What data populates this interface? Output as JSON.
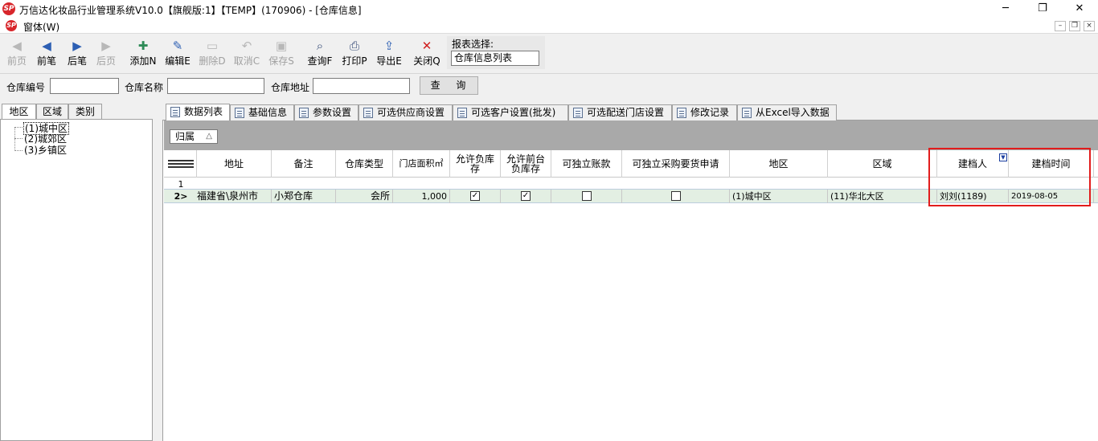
{
  "window": {
    "title": "万信达化妆品行业管理系统V10.0【旗舰版:1】【TEMP】(170906) - [仓库信息]",
    "logo_text": "SP",
    "minimize": "─",
    "restore": "❐",
    "close": "✕"
  },
  "menubar": {
    "menu": "窗体(W)",
    "mdi_minimize": "–",
    "mdi_restore": "❐",
    "mdi_close": "×"
  },
  "toolbar": {
    "items": [
      {
        "label": "前页",
        "icon": "first-page-icon",
        "glyph": "◀",
        "enabled": false
      },
      {
        "label": "前笔",
        "icon": "prev-record-icon",
        "glyph": "◀",
        "enabled": true
      },
      {
        "label": "后笔",
        "icon": "next-record-icon",
        "glyph": "▶",
        "enabled": true
      },
      {
        "label": "后页",
        "icon": "last-page-icon",
        "glyph": "▶",
        "enabled": false
      },
      {
        "label": "添加N",
        "icon": "add-icon",
        "glyph": "✚",
        "enabled": true
      },
      {
        "label": "编辑E",
        "icon": "edit-icon",
        "glyph": "✎",
        "enabled": true
      },
      {
        "label": "删除D",
        "icon": "delete-icon",
        "glyph": "▭",
        "enabled": false
      },
      {
        "label": "取消C",
        "icon": "undo-icon",
        "glyph": "↶",
        "enabled": false
      },
      {
        "label": "保存S",
        "icon": "save-icon",
        "glyph": "▣",
        "enabled": false
      },
      {
        "label": "查询F",
        "icon": "find-icon",
        "glyph": "⌕",
        "enabled": true
      },
      {
        "label": "打印P",
        "icon": "printer-icon",
        "glyph": "⎙",
        "enabled": true
      },
      {
        "label": "导出E",
        "icon": "export-icon",
        "glyph": "⇪",
        "enabled": true
      },
      {
        "label": "关闭Q",
        "icon": "close-x-icon",
        "glyph": "✕",
        "enabled": true
      }
    ],
    "report_label": "报表选择:",
    "report_value": "仓库信息列表"
  },
  "search": {
    "code_label": "仓库编号",
    "code_value": "",
    "name_label": "仓库名称",
    "name_value": "",
    "addr_label": "仓库地址",
    "addr_value": "",
    "query_button": "查 询"
  },
  "left": {
    "tabs": [
      "地区",
      "区域",
      "类别"
    ],
    "tree": [
      "(1)城中区",
      "(2)城郊区",
      "(3)乡镇区"
    ]
  },
  "tabs": [
    "数据列表",
    "基础信息",
    "参数设置",
    "可选供应商设置",
    "可选客户设置(批发)",
    "可选配送门店设置",
    "修改记录",
    "从Excel导入数据"
  ],
  "grid": {
    "group_label": "归属",
    "group_sort": "△",
    "columns": {
      "address": "地址",
      "remark": "备注",
      "type": "仓库类型",
      "area": "门店面积㎡",
      "neg_stock_1": "允许负库",
      "neg_stock_2": "存",
      "front_neg_1": "允许前台",
      "front_neg_2": "负库存",
      "independent_account": "可独立账款",
      "independent_purchase": "可独立采购要货申请",
      "region": "地区",
      "zone": "区域",
      "creator": "建档人",
      "created_at": "建档时间"
    },
    "rows": [
      {
        "num": "1"
      },
      {
        "num": "2>",
        "address": "福建省\\泉州市",
        "remark": "小郑仓库",
        "type": "会所",
        "area": "1,000",
        "neg_stock": "✓",
        "front_neg": "✓",
        "independent_account": "",
        "independent_purchase": "",
        "region": "(1)城中区",
        "zone": "(11)华北大区",
        "creator": "刘刘(1189)",
        "created_at": "2019-08-05"
      }
    ]
  },
  "colors": {
    "highlight": "#e21c1c",
    "selected_row": "#e3efe3",
    "group_bar": "#a9a9a9"
  }
}
